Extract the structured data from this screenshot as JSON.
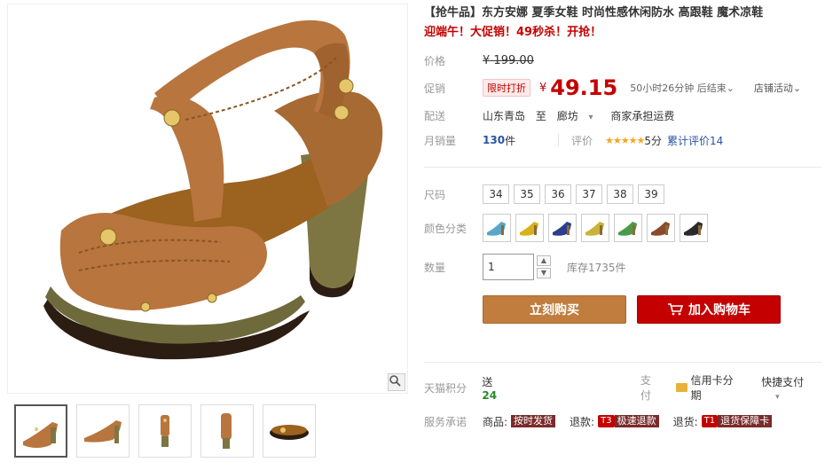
{
  "product": {
    "title": "【抢牛品】东方安娜 夏季女鞋 时尚性感休闲防水 高跟鞋 魔术凉鞋",
    "promo": "迎端午！大促销！49秒杀！开抢！"
  },
  "price": {
    "label": "价格",
    "currency": "¥",
    "original": "199.00",
    "promo_label": "促销",
    "promo_tag": "限时打折",
    "current": "49.15",
    "countdown": "50小时26分钟 后结束",
    "countdown_caret": "⌄",
    "shop_activity": "店铺活动",
    "shop_activity_caret": "⌄"
  },
  "shipping": {
    "label": "配送",
    "from": "山东青岛",
    "to_word": "至",
    "to": "廊坊",
    "to_caret": "▾",
    "fee": "商家承担运费"
  },
  "sales": {
    "label": "月销量",
    "count": "130",
    "unit": "件",
    "rating_label": "评价",
    "stars": "★★★★★",
    "score": "5分",
    "reviews": "累计评价14"
  },
  "sku": {
    "size_label": "尺码",
    "sizes": [
      "34",
      "35",
      "36",
      "37",
      "38",
      "39"
    ],
    "color_label": "颜色分类",
    "color_icon": "sandal-swatch-icon",
    "colors": [
      "#5aa6c8",
      "#d8b11c",
      "#2c3e8c",
      "#c9b33a",
      "#4a9a4a",
      "#8a4b2a",
      "#2a2a2a"
    ],
    "qty_label": "数量",
    "qty_value": "1",
    "qty_up": "▲",
    "qty_down": "▼",
    "stock": "库存1735件"
  },
  "buttons": {
    "buy": "立刻购买",
    "cart": "加入购物车",
    "cart_icon": "cart-icon"
  },
  "bottom": {
    "points_label": "天猫积分",
    "points_prefix": "送",
    "points": "24",
    "pay_label": "支付",
    "pay_icon": "credit-card-icon",
    "pay_text": "信用卡分期",
    "quick_pay": "快捷支付",
    "quick_caret": "▾",
    "service_label": "服务承诺",
    "services": [
      {
        "prefix": "商品:",
        "tag": "",
        "text": "按时发货"
      },
      {
        "prefix": "退款:",
        "tag": "T3",
        "text": "极速退款"
      },
      {
        "prefix": "退货:",
        "tag": "T1",
        "text": "退货保障卡"
      }
    ]
  },
  "gallery": {
    "zoom_icon": "magnifier-icon",
    "thumb_icon": "sandal-thumbnail-icon",
    "thumb_count": 5,
    "active_thumb": 1
  },
  "colors": {
    "accent_red": "#c40000",
    "buy_brown": "#c07d3e",
    "link_blue": "#2953a6",
    "shoe_tan": "#b8753e"
  }
}
